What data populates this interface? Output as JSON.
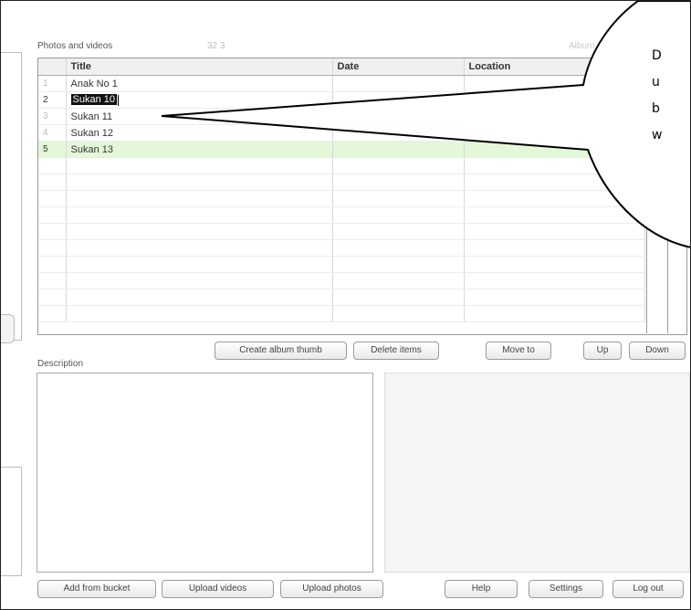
{
  "photos": {
    "section_label": "Photos and videos",
    "count_label": "32 3",
    "album_label": "Album",
    "columns": [
      "",
      "Title",
      "Date",
      "Location"
    ],
    "rows": [
      {
        "num": "1",
        "title": "Anak No 1",
        "date": "",
        "location": "",
        "state": "normal"
      },
      {
        "num": "2",
        "title": "Sukan 10",
        "date": "",
        "location": "",
        "state": "editing"
      },
      {
        "num": "3",
        "title": "Sukan 11",
        "date": "",
        "location": "",
        "state": "normal"
      },
      {
        "num": "4",
        "title": "Sukan 12",
        "date": "",
        "location": "",
        "state": "normal"
      },
      {
        "num": "5",
        "title": "Sukan 13",
        "date": "",
        "location": "",
        "state": "highlighted"
      }
    ]
  },
  "toolbar": {
    "create_thumb": "Create album thumb",
    "delete_items": "Delete items",
    "move_to": "Move to",
    "up": "Up",
    "down": "Down"
  },
  "description": {
    "label": "Description"
  },
  "bottom_bar": {
    "add_from_bucket": "Add from bucket",
    "upload_videos": "Upload videos",
    "upload_photos": "Upload photos",
    "help": "Help",
    "settings": "Settings",
    "log_out": "Log out"
  },
  "callout": {
    "lines": [
      "D",
      "u",
      "b",
      "w"
    ]
  },
  "colors": {
    "highlight_row": "#e3f8d8",
    "selected_text_bg": "#111111"
  }
}
